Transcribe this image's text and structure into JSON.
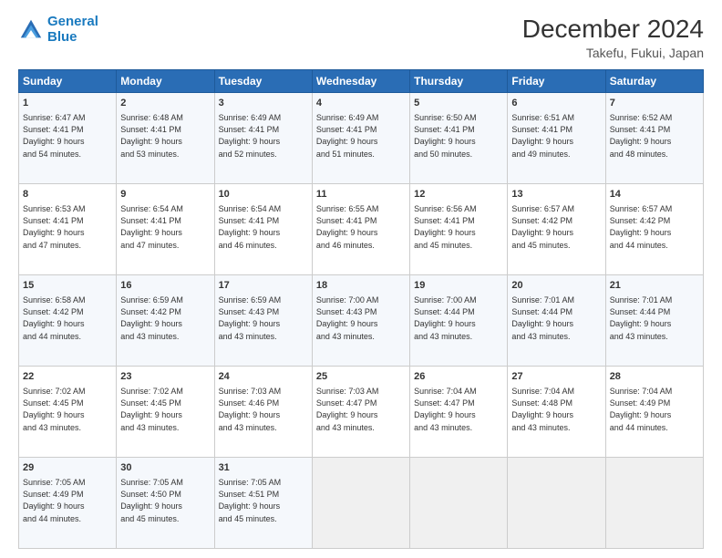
{
  "header": {
    "logo_line1": "General",
    "logo_line2": "Blue",
    "title": "December 2024",
    "subtitle": "Takefu, Fukui, Japan"
  },
  "weekdays": [
    "Sunday",
    "Monday",
    "Tuesday",
    "Wednesday",
    "Thursday",
    "Friday",
    "Saturday"
  ],
  "weeks": [
    [
      {
        "day": 1,
        "info": "Sunrise: 6:47 AM\nSunset: 4:41 PM\nDaylight: 9 hours\nand 54 minutes."
      },
      {
        "day": 2,
        "info": "Sunrise: 6:48 AM\nSunset: 4:41 PM\nDaylight: 9 hours\nand 53 minutes."
      },
      {
        "day": 3,
        "info": "Sunrise: 6:49 AM\nSunset: 4:41 PM\nDaylight: 9 hours\nand 52 minutes."
      },
      {
        "day": 4,
        "info": "Sunrise: 6:49 AM\nSunset: 4:41 PM\nDaylight: 9 hours\nand 51 minutes."
      },
      {
        "day": 5,
        "info": "Sunrise: 6:50 AM\nSunset: 4:41 PM\nDaylight: 9 hours\nand 50 minutes."
      },
      {
        "day": 6,
        "info": "Sunrise: 6:51 AM\nSunset: 4:41 PM\nDaylight: 9 hours\nand 49 minutes."
      },
      {
        "day": 7,
        "info": "Sunrise: 6:52 AM\nSunset: 4:41 PM\nDaylight: 9 hours\nand 48 minutes."
      }
    ],
    [
      {
        "day": 8,
        "info": "Sunrise: 6:53 AM\nSunset: 4:41 PM\nDaylight: 9 hours\nand 47 minutes."
      },
      {
        "day": 9,
        "info": "Sunrise: 6:54 AM\nSunset: 4:41 PM\nDaylight: 9 hours\nand 47 minutes."
      },
      {
        "day": 10,
        "info": "Sunrise: 6:54 AM\nSunset: 4:41 PM\nDaylight: 9 hours\nand 46 minutes."
      },
      {
        "day": 11,
        "info": "Sunrise: 6:55 AM\nSunset: 4:41 PM\nDaylight: 9 hours\nand 46 minutes."
      },
      {
        "day": 12,
        "info": "Sunrise: 6:56 AM\nSunset: 4:41 PM\nDaylight: 9 hours\nand 45 minutes."
      },
      {
        "day": 13,
        "info": "Sunrise: 6:57 AM\nSunset: 4:42 PM\nDaylight: 9 hours\nand 45 minutes."
      },
      {
        "day": 14,
        "info": "Sunrise: 6:57 AM\nSunset: 4:42 PM\nDaylight: 9 hours\nand 44 minutes."
      }
    ],
    [
      {
        "day": 15,
        "info": "Sunrise: 6:58 AM\nSunset: 4:42 PM\nDaylight: 9 hours\nand 44 minutes."
      },
      {
        "day": 16,
        "info": "Sunrise: 6:59 AM\nSunset: 4:42 PM\nDaylight: 9 hours\nand 43 minutes."
      },
      {
        "day": 17,
        "info": "Sunrise: 6:59 AM\nSunset: 4:43 PM\nDaylight: 9 hours\nand 43 minutes."
      },
      {
        "day": 18,
        "info": "Sunrise: 7:00 AM\nSunset: 4:43 PM\nDaylight: 9 hours\nand 43 minutes."
      },
      {
        "day": 19,
        "info": "Sunrise: 7:00 AM\nSunset: 4:44 PM\nDaylight: 9 hours\nand 43 minutes."
      },
      {
        "day": 20,
        "info": "Sunrise: 7:01 AM\nSunset: 4:44 PM\nDaylight: 9 hours\nand 43 minutes."
      },
      {
        "day": 21,
        "info": "Sunrise: 7:01 AM\nSunset: 4:44 PM\nDaylight: 9 hours\nand 43 minutes."
      }
    ],
    [
      {
        "day": 22,
        "info": "Sunrise: 7:02 AM\nSunset: 4:45 PM\nDaylight: 9 hours\nand 43 minutes."
      },
      {
        "day": 23,
        "info": "Sunrise: 7:02 AM\nSunset: 4:45 PM\nDaylight: 9 hours\nand 43 minutes."
      },
      {
        "day": 24,
        "info": "Sunrise: 7:03 AM\nSunset: 4:46 PM\nDaylight: 9 hours\nand 43 minutes."
      },
      {
        "day": 25,
        "info": "Sunrise: 7:03 AM\nSunset: 4:47 PM\nDaylight: 9 hours\nand 43 minutes."
      },
      {
        "day": 26,
        "info": "Sunrise: 7:04 AM\nSunset: 4:47 PM\nDaylight: 9 hours\nand 43 minutes."
      },
      {
        "day": 27,
        "info": "Sunrise: 7:04 AM\nSunset: 4:48 PM\nDaylight: 9 hours\nand 43 minutes."
      },
      {
        "day": 28,
        "info": "Sunrise: 7:04 AM\nSunset: 4:49 PM\nDaylight: 9 hours\nand 44 minutes."
      }
    ],
    [
      {
        "day": 29,
        "info": "Sunrise: 7:05 AM\nSunset: 4:49 PM\nDaylight: 9 hours\nand 44 minutes."
      },
      {
        "day": 30,
        "info": "Sunrise: 7:05 AM\nSunset: 4:50 PM\nDaylight: 9 hours\nand 45 minutes."
      },
      {
        "day": 31,
        "info": "Sunrise: 7:05 AM\nSunset: 4:51 PM\nDaylight: 9 hours\nand 45 minutes."
      },
      null,
      null,
      null,
      null
    ]
  ]
}
